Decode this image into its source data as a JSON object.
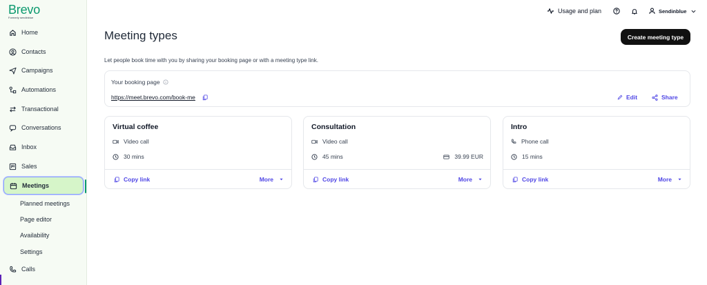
{
  "brand": {
    "name": "Brevo",
    "subtitle": "Formerly sendinblue"
  },
  "sidebar": {
    "items": [
      {
        "label": "Home",
        "icon": "home-icon"
      },
      {
        "label": "Contacts",
        "icon": "contacts-icon"
      },
      {
        "label": "Campaigns",
        "icon": "send-icon"
      },
      {
        "label": "Automations",
        "icon": "automation-icon"
      },
      {
        "label": "Transactional",
        "icon": "transfer-icon"
      },
      {
        "label": "Conversations",
        "icon": "chat-icon"
      },
      {
        "label": "Inbox",
        "icon": "inbox-icon"
      },
      {
        "label": "Sales",
        "icon": "sales-board-icon"
      },
      {
        "label": "Meetings",
        "icon": "calendar-icon",
        "active": true
      },
      {
        "label": "Calls",
        "icon": "phone-icon"
      }
    ],
    "subitems": [
      "Planned meetings",
      "Page editor",
      "Availability",
      "Settings"
    ]
  },
  "topbar": {
    "usage_label": "Usage and plan",
    "account_label": "Sendinblue"
  },
  "main": {
    "title": "Meeting types",
    "create_button": "Create meeting type",
    "intro": "Let people book time with you by sharing your booking page or with a meeting type link.",
    "booking": {
      "label": "Your booking page",
      "url": "https://meet.brevo.com/book-me",
      "edit_label": "Edit",
      "share_label": "Share"
    },
    "meeting_types": [
      {
        "title": "Virtual coffee",
        "type": "Video call",
        "type_icon": "video-icon",
        "duration": "30 mins",
        "price": ""
      },
      {
        "title": "Consultation",
        "type": "Video call",
        "type_icon": "video-icon",
        "duration": "45 mins",
        "price": "39.99 EUR"
      },
      {
        "title": "Intro",
        "type": "Phone call",
        "type_icon": "phone-icon",
        "duration": "15 mins",
        "price": ""
      }
    ],
    "copy_link_label": "Copy link",
    "more_label": "More"
  },
  "colors": {
    "brand_green": "#0b996e",
    "accent": "#4f46e5",
    "active_bg": "#d6f5c9"
  }
}
